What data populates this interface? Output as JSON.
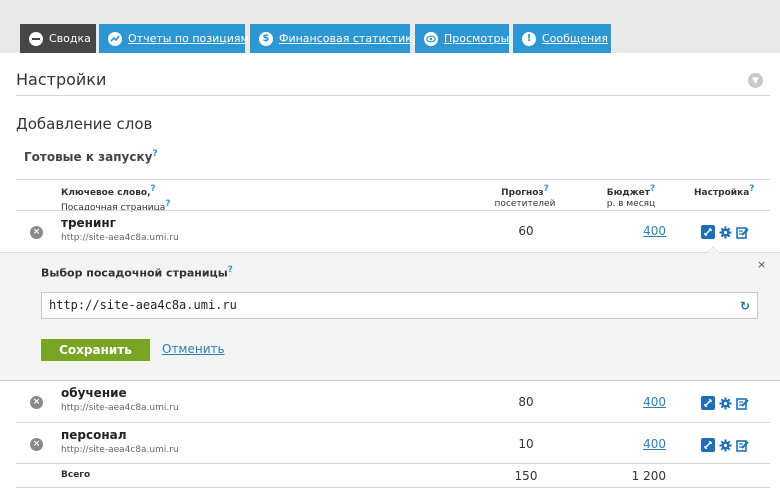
{
  "tabs": [
    {
      "label": "Сводка",
      "icon": "minus-circle-icon"
    },
    {
      "label": "Отчеты по позициям",
      "icon": "trend-icon"
    },
    {
      "label": "Финансовая статистика",
      "icon": "dollar-icon"
    },
    {
      "label": "Просмотры",
      "icon": "eye-icon"
    },
    {
      "label": "Сообщения",
      "icon": "exclamation-icon"
    }
  ],
  "settings_title": "Настройки",
  "add_words_title": "Добавление слов",
  "ready_title": "Готовые к запуску",
  "help_mark": "?",
  "columns": {
    "keyword": "Ключевое слово,",
    "landing": "Посадочная страница",
    "forecast": "Прогноз",
    "forecast_sub": "посетителей",
    "budget": "Бюджет",
    "budget_sub": "р. в месяц",
    "settings": "Настройка"
  },
  "rows": [
    {
      "keyword": "тренинг",
      "url": "http://site-aea4c8a.umi.ru",
      "forecast": "60",
      "budget": "400"
    },
    {
      "keyword": "обучение",
      "url": "http://site-aea4c8a.umi.ru",
      "forecast": "80",
      "budget": "400"
    },
    {
      "keyword": "персонал",
      "url": "http://site-aea4c8a.umi.ru",
      "forecast": "10",
      "budget": "400"
    }
  ],
  "panel": {
    "title": "Выбор посадочной страницы",
    "input_value": "http://site-aea4c8a.umi.ru",
    "save_label": "Сохранить",
    "cancel_label": "Отменить",
    "close_glyph": "×"
  },
  "totals": {
    "label": "Всего",
    "forecast": "150",
    "budget": "1 200"
  },
  "colors": {
    "accent": "#2c97d3",
    "active_tab": "#464646",
    "save": "#7aa524",
    "link": "#2c7fb8"
  }
}
